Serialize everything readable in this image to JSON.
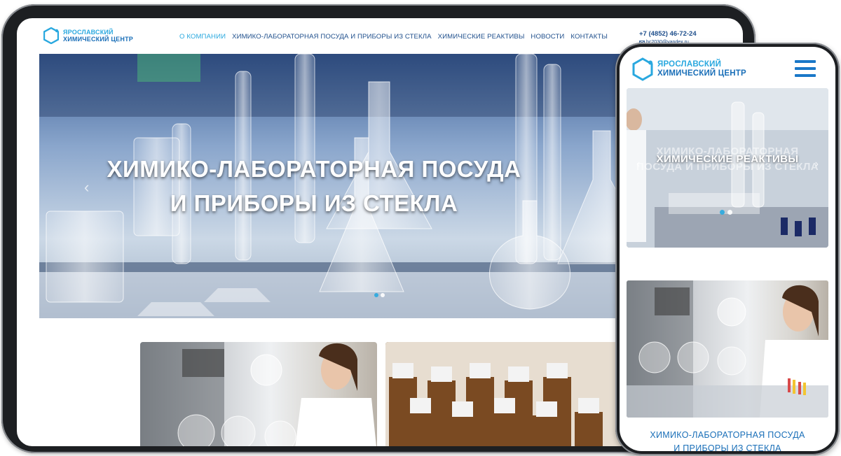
{
  "tablet": {
    "logo": {
      "line1": "ЯРОСЛАВСКИЙ",
      "line2": "ХИМИЧЕСКИЙ ЦЕНТР"
    },
    "nav": [
      {
        "label": "О КОМПАНИИ",
        "active": true
      },
      {
        "label": "ХИМИКО-ЛАБОРАТОРНАЯ ПОСУДА И ПРИБОРЫ ИЗ СТЕКЛА",
        "active": false
      },
      {
        "label": "ХИМИЧЕСКИЕ РЕАКТИВЫ",
        "active": false
      },
      {
        "label": "НОВОСТИ",
        "active": false
      },
      {
        "label": "КОНТАКТЫ",
        "active": false
      }
    ],
    "phone": "+7 (4852) 46-72-24",
    "email": "hc2030@yandex.ru",
    "hero": {
      "title_line1": "ХИМИКО-ЛАБОРАТОРНАЯ ПОСУДА",
      "title_line2": "И ПРИБОРЫ ИЗ СТЕКЛА"
    }
  },
  "phone_view": {
    "logo": {
      "line1": "ЯРОСЛАВСКИЙ",
      "line2": "ХИМИЧЕСКИЙ ЦЕНТР"
    },
    "hero": {
      "ghost_line1": "ХИМИКО-ЛАБОРАТОРНАЯ",
      "ghost_line2": "ПОСУДА И ПРИБОРЫ ИЗ СТЕКЛА",
      "title": "ХИМИЧЕСКИЕ РЕАКТИВЫ"
    },
    "card": {
      "title_line1": "ХИМИКО-ЛАБОРАТОРНАЯ ПОСУДА",
      "title_line2": "И ПРИБОРЫ ИЗ СТЕКЛА"
    }
  },
  "colors": {
    "accent": "#29a8df",
    "brand_dark": "#1a6fb8",
    "nav_text": "#1f4f8c",
    "frame": "#1d1f22"
  },
  "icons": [
    "hexagon-logo-icon",
    "mail-icon",
    "chevron-left-icon",
    "chevron-right-icon",
    "hamburger-menu-icon"
  ]
}
